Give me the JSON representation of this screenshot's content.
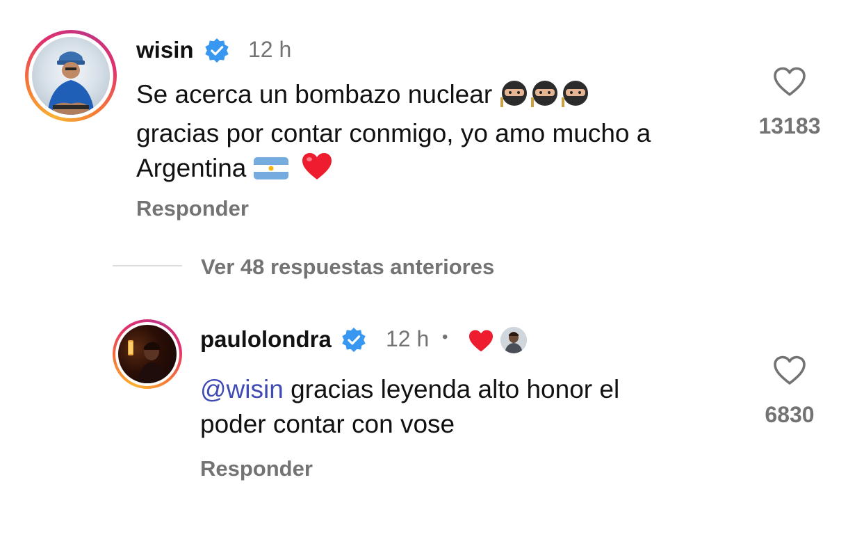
{
  "comment": {
    "username": "wisin",
    "time": "12 h",
    "line1": "Se acerca un bombazo nuclear",
    "line2": "gracias por contar conmigo, yo amo mucho a",
    "line3": "Argentina",
    "emojis": [
      "ninja-emoji",
      "ninja-emoji",
      "ninja-emoji",
      "argentina-flag-emoji",
      "red-heart-emoji"
    ],
    "like_count": "13183",
    "reply_label": "Responder"
  },
  "view_more": {
    "label": "Ver 48 respuestas anteriores"
  },
  "reply": {
    "username": "paulolondra",
    "time": "12 h",
    "separator": "•",
    "mention": "@wisin",
    "line1_rest": " gracias leyenda alto honor el",
    "line2": "poder contar con vose",
    "like_count": "6830",
    "reply_label": "Responder"
  },
  "colors": {
    "verified_blue": "#3897f0",
    "secondary_text": "#737373",
    "mention": "#3f4ab3",
    "heart_red": "#ed1c2e"
  }
}
